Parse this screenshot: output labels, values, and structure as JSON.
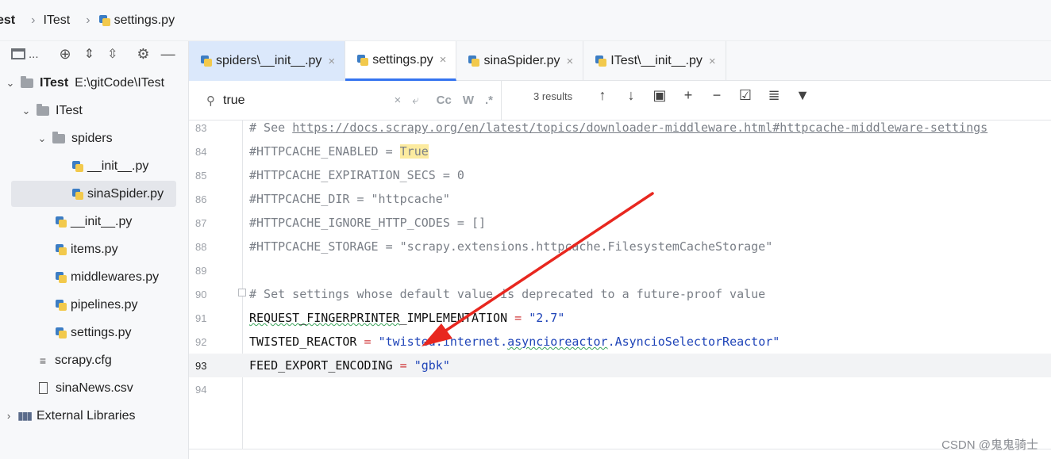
{
  "breadcrumb": {
    "items": [
      "est",
      "ITest",
      "settings.py"
    ]
  },
  "sidebar": {
    "toolbar": {
      "ellipsis": "...",
      "icons": [
        "project-view-icon",
        "locate-icon",
        "expand-all-icon",
        "collapse-all-icon",
        "gear-icon",
        "minimize-icon"
      ]
    },
    "tree": [
      {
        "label": "ITest",
        "path": "E:\\gitCode\\ITest",
        "kind": "module",
        "expanded": true
      },
      {
        "label": "ITest",
        "kind": "folder",
        "expanded": true
      },
      {
        "label": "spiders",
        "kind": "folder",
        "expanded": true
      },
      {
        "label": "__init__.py",
        "kind": "python"
      },
      {
        "label": "sinaSpider.py",
        "kind": "python",
        "selected": true
      },
      {
        "label": "__init__.py",
        "kind": "python"
      },
      {
        "label": "items.py",
        "kind": "python"
      },
      {
        "label": "middlewares.py",
        "kind": "python"
      },
      {
        "label": "pipelines.py",
        "kind": "python"
      },
      {
        "label": "settings.py",
        "kind": "python"
      },
      {
        "label": "scrapy.cfg",
        "kind": "config"
      },
      {
        "label": "sinaNews.csv",
        "kind": "csv"
      },
      {
        "label": "External Libraries",
        "kind": "library",
        "expanded": false
      }
    ]
  },
  "tabs": [
    {
      "label": "spiders\\__init__.py",
      "close": "×"
    },
    {
      "label": "settings.py",
      "close": "×",
      "active": true
    },
    {
      "label": "sinaSpider.py",
      "close": "×"
    },
    {
      "label": "ITest\\__init__.py",
      "close": "×"
    }
  ],
  "find": {
    "query": "true",
    "options": [
      "Cc",
      "W",
      ".*"
    ],
    "results": "3 results"
  },
  "editor": {
    "current_line": 93,
    "lines": [
      {
        "n": "83",
        "text": "# See https://docs.scrapy.org/en/latest/topics/downloader-middleware.html#httpcache-middleware-settings"
      },
      {
        "n": "84",
        "text": "#HTTPCACHE_ENABLED = True"
      },
      {
        "n": "85",
        "text": "#HTTPCACHE_EXPIRATION_SECS = 0"
      },
      {
        "n": "86",
        "text": "#HTTPCACHE_DIR = \"httpcache\""
      },
      {
        "n": "87",
        "text": "#HTTPCACHE_IGNORE_HTTP_CODES = []"
      },
      {
        "n": "88",
        "text": "#HTTPCACHE_STORAGE = \"scrapy.extensions.httpcache.FilesystemCacheStorage\""
      },
      {
        "n": "89",
        "text": ""
      },
      {
        "n": "90",
        "text": "# Set settings whose default value is deprecated to a future-proof value"
      },
      {
        "n": "91",
        "text": "REQUEST_FINGERPRINTER_IMPLEMENTATION = \"2.7\""
      },
      {
        "n": "92",
        "text": "TWISTED_REACTOR = \"twisted.internet.asyncioreactor.AsyncioSelectorReactor\""
      },
      {
        "n": "93",
        "text": "FEED_EXPORT_ENCODING = \"gbk\""
      },
      {
        "n": "94",
        "text": ""
      }
    ]
  },
  "annotation": {
    "arrow_color": "#e8271f"
  },
  "watermark": "CSDN @鬼鬼骑士"
}
